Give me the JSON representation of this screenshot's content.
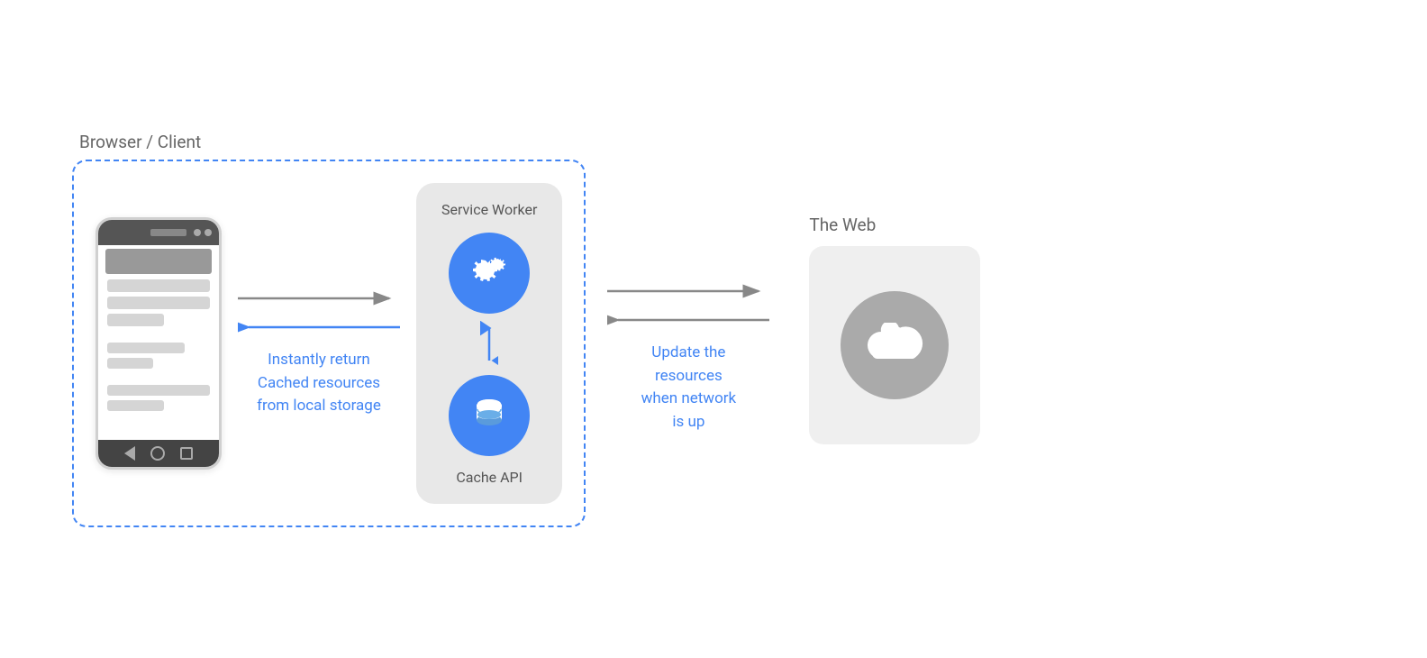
{
  "labels": {
    "browser_client": "Browser / Client",
    "the_web": "The Web",
    "service_worker": "Service Worker",
    "cache_api": "Cache API",
    "instantly_return": "Instantly return",
    "cached_resources": "Cached resources",
    "from_local_storage": "from local storage",
    "update_the": "Update the",
    "resources": "resources",
    "when_network": "when network",
    "is_up": "is up"
  },
  "colors": {
    "blue": "#4285f4",
    "dashed_border": "#4285f4",
    "text_label": "#666",
    "text_blue": "#4285f4",
    "sw_bg": "#e8e8e8",
    "web_bg": "#efefef",
    "cloud_circle": "#999",
    "phone_status": "#555",
    "phone_nav": "#888"
  }
}
